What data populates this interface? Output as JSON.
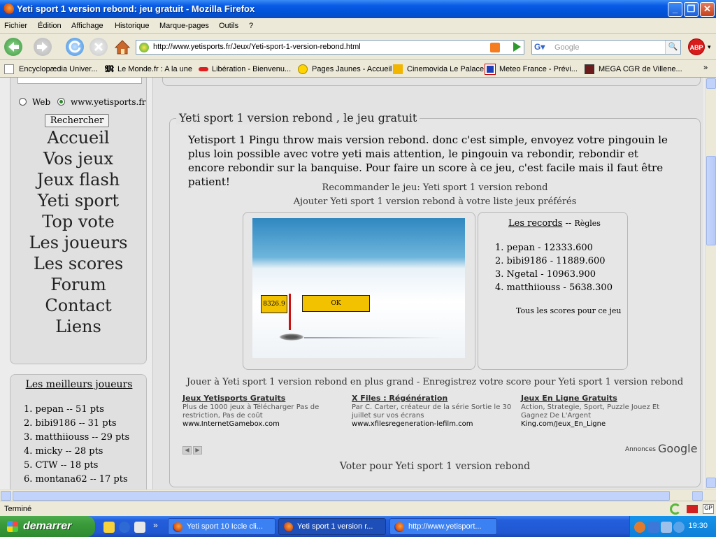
{
  "window": {
    "title": "Yeti sport 1 version rebond: jeu gratuit - Mozilla Firefox"
  },
  "menu": [
    "Fichier",
    "Édition",
    "Affichage",
    "Historique",
    "Marque-pages",
    "Outils",
    "?"
  ],
  "urlbar": {
    "url": "http://www.yetisports.fr/Jeux/Yeti-sport-1-version-rebond.html"
  },
  "searchbar": {
    "placeholder": "Google"
  },
  "abp": "ABP",
  "bookmarks": [
    "Encyclopædia Univer...",
    "Le Monde.fr : A la une",
    "Libération - Bienvenu...",
    "Pages Jaunes - Accueil",
    "Cinemovida Le Palace",
    "Meteo France - Prévi...",
    "MEGA CGR de Villene..."
  ],
  "sidebar": {
    "radio_web": "Web",
    "radio_site": "www.yetisports.fr",
    "search_button": "Rechercher",
    "nav": [
      "Accueil",
      "Vos jeux",
      "Jeux flash",
      "Yeti sport",
      "Top vote",
      "Les joueurs",
      "Les scores",
      "Forum",
      "Contact",
      "Liens"
    ],
    "best_title": "Les meilleurs joueurs",
    "best": [
      "1.  pepan -- 51 pts",
      "2.  bibi9186 -- 31 pts",
      "3.  matthiiouss -- 29 pts",
      "4.  micky -- 28 pts",
      "5.  CTW -- 18 pts",
      "6.  montana62 -- 17 pts"
    ]
  },
  "main": {
    "legend": "Yeti sport 1 version rebond , le jeu gratuit",
    "intro": "Yetisport 1 Pingu throw mais version rebond. donc c'est simple, envoyez votre pingouin le plus loin possible avec votre yeti mais attention, le pingouin va rebondir, rebondir et encore rebondir sur la banquise. Pour faire un score à ce jeu, c'est facile mais il faut être patient!",
    "recommend": "Recommander le jeu: Yeti sport 1 version rebond",
    "add_fav": "Ajouter Yeti sport 1 version rebond à votre liste jeux préférés",
    "game": {
      "score": "8326.9",
      "ok": "OK"
    },
    "records": {
      "title": "Les records",
      "sep": "--",
      "rules": "Règles",
      "items": [
        "1.   pepan - 12333.600",
        "2.   bibi9186 - 11889.600",
        "3.   Ngetal - 10963.900",
        "4.   matthiiouss - 5638.300"
      ],
      "all": "Tous les scores pour ce jeu"
    },
    "bigger": "Jouer à Yeti sport 1 version rebond en plus grand - Enregistrez votre score pour Yeti sport 1 version rebond",
    "ads": [
      {
        "title": "Jeux Yetisports Gratuits",
        "desc": "Plus de 1000 jeux à Télécharger Pas de restriction, Pas de coût",
        "url": "www.InternetGamebox.com"
      },
      {
        "title": "X Files : Régénération",
        "desc": "Par C. Carter, créateur de la série Sortie le 30 juillet sur vos écrans",
        "url": "www.xfilesregeneration-lefilm.com"
      },
      {
        "title": "Jeux En Ligne Gratuits",
        "desc": "Action, Strategie, Sport, Puzzle Jouez Et Gagnez De L'Argent",
        "url": "King.com/Jeux_En_Ligne"
      }
    ],
    "ads_label": "Annonces",
    "ads_brand": "Google",
    "vote": "Voter pour Yeti sport 1 version rebond"
  },
  "status": "Terminé",
  "taskbar": {
    "start": "demarrer",
    "tasks": [
      "Yeti sport 10 Iccle cli...",
      "Yeti sport 1 version r...",
      "http://www.yetisport..."
    ],
    "clock": "19:30"
  }
}
